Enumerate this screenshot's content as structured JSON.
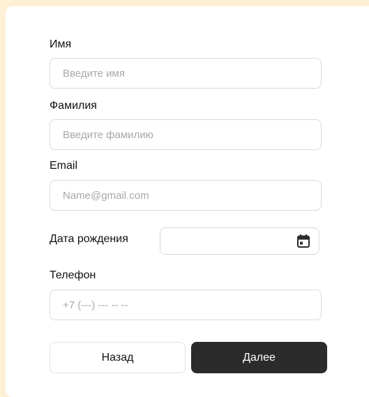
{
  "form": {
    "first_name": {
      "label": "Имя",
      "placeholder": "Введите имя",
      "value": ""
    },
    "last_name": {
      "label": "Фамилия",
      "placeholder": "Введите фамилию",
      "value": ""
    },
    "email": {
      "label": "Email",
      "placeholder": "Name@gmail.com",
      "value": ""
    },
    "birth_date": {
      "label": "Дата рождения",
      "icon": "calendar-icon",
      "value": ""
    },
    "phone": {
      "label": "Телефон",
      "placeholder": "+7 (---) --- -- --",
      "value": ""
    }
  },
  "buttons": {
    "back_label": "Назад",
    "next_label": "Далее"
  },
  "colors": {
    "page_background": "#fdf0d5",
    "card_background": "#ffffff",
    "primary_button": "#2b2b2b",
    "input_border": "#d9d9d9"
  }
}
